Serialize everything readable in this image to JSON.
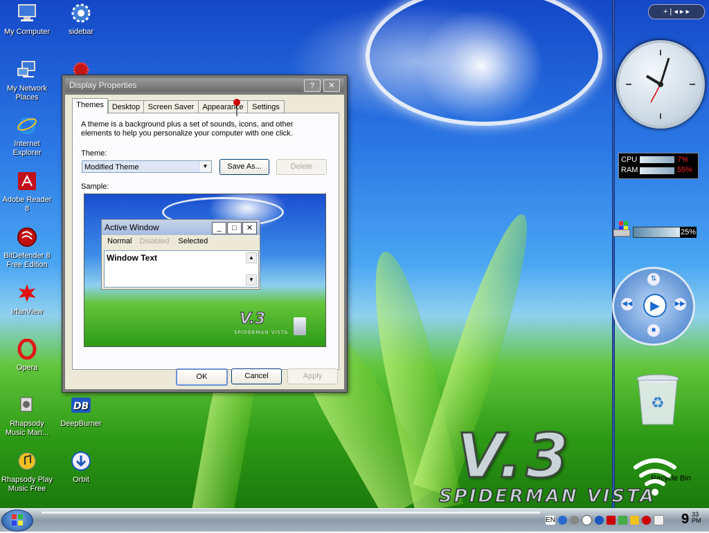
{
  "desktop": {
    "icons": [
      {
        "label": "My Computer"
      },
      {
        "label": "sidebar"
      },
      {
        "label": "My Network Places"
      },
      {
        "label": "Internet Explorer"
      },
      {
        "label": "Adobe Reader 8"
      },
      {
        "label": "BitDefender 8 Free Edition"
      },
      {
        "label": "IrfanView"
      },
      {
        "label": "Opera"
      },
      {
        "label": "Rhapsody Music Man..."
      },
      {
        "label": "DeepBurner"
      },
      {
        "label": "Rhapsody Play Music Free"
      },
      {
        "label": "Orbit"
      },
      {
        "label": "Recycle Bin"
      }
    ],
    "wallpaper": {
      "logo": "V.3",
      "subtitle": "SPIDERMAN VISTA"
    }
  },
  "dialog": {
    "title": "Display Properties",
    "help_label": "?",
    "close_label": "✕",
    "tabs": [
      "Themes",
      "Desktop",
      "Screen Saver",
      "Appearance",
      "Settings"
    ],
    "active_tab": "Themes",
    "description": "A theme is a background plus a set of sounds, icons, and other elements to help you personalize your computer with one click.",
    "theme_label": "Theme:",
    "theme_value": "Modified Theme",
    "save_as_label": "Save As...",
    "delete_label": "Delete",
    "sample_label": "Sample:",
    "preview": {
      "window_title": "Active Window",
      "menu": [
        "Normal",
        "Disabled",
        "Selected"
      ],
      "text": "Window Text",
      "logo": "V.3",
      "logo_sub": "SPIDERMAN VISTA"
    },
    "ok_label": "OK",
    "cancel_label": "Cancel",
    "apply_label": "Apply"
  },
  "gadgets": {
    "cpu_label": "CPU",
    "cpu_value": "7%",
    "ram_label": "RAM",
    "ram_value": "55%",
    "disk_value": "25%"
  },
  "taskbar": {
    "language": "EN",
    "clock": "9",
    "clock_minutes": "33",
    "clock_ampm": "PM"
  },
  "colors": {
    "accent_red": "#ff2020",
    "window_body": "#ece9d8"
  }
}
